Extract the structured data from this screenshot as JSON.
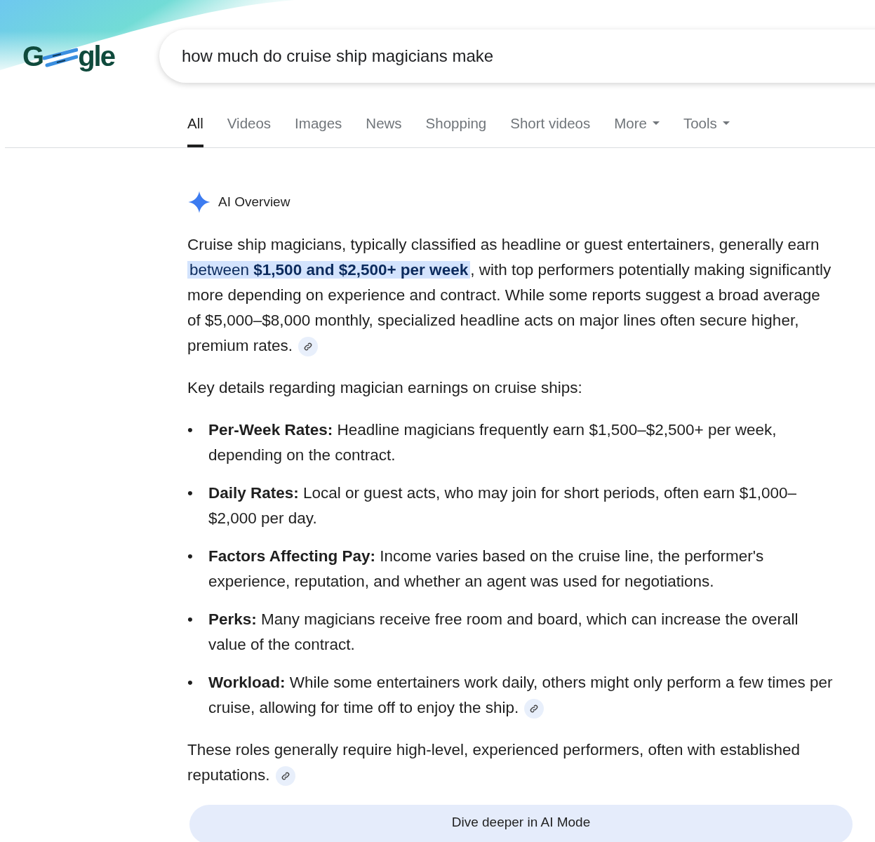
{
  "logo": {
    "first": "G",
    "last": "gle"
  },
  "search": {
    "value": "how much do cruise ship magicians make"
  },
  "tabs": [
    {
      "label": "All",
      "selected": true,
      "menu": false
    },
    {
      "label": "Videos",
      "selected": false,
      "menu": false
    },
    {
      "label": "Images",
      "selected": false,
      "menu": false
    },
    {
      "label": "News",
      "selected": false,
      "menu": false
    },
    {
      "label": "Shopping",
      "selected": false,
      "menu": false
    },
    {
      "label": "Short videos",
      "selected": false,
      "menu": false
    },
    {
      "label": "More",
      "selected": false,
      "menu": true
    },
    {
      "label": "Tools",
      "selected": false,
      "menu": true
    }
  ],
  "overview": {
    "title": "AI Overview",
    "intro": {
      "before": "Cruise ship magicians, typically classified as headline or guest entertainers, generally earn ",
      "highlight": "between **$1,500 and $2,500+ per week**",
      "after": ", with top performers potentially making significantly more depending on experience and contract. While some reports suggest a broad average of $5,000–$8,000 monthly, specialized headline acts on major lines often secure higher, premium rates.",
      "link": true
    },
    "lead": "Key details regarding magician earnings on cruise ships:",
    "bullets": [
      {
        "marker": "•",
        "text": "**Per-Week Rates:** Headline magicians frequently earn $1,500–$2,500+ per week, depending on the contract.",
        "link": false
      },
      {
        "marker": "•",
        "text": "**Daily Rates:** Local or guest acts, who may join for short periods, often earn $1,000–$2,000 per day.",
        "link": false
      },
      {
        "marker": "•",
        "text": "**Factors Affecting Pay:** Income varies based on the cruise line, the performer's experience, reputation, and whether an agent was used for negotiations.",
        "link": false
      },
      {
        "marker": "•",
        "text": "**Perks:** Many magicians receive free room and board, which can increase the overall value of the contract.",
        "link": false
      },
      {
        "marker": "•",
        "text": "**Workload:** While some entertainers work daily, others might only perform a few times per cruise, allowing for time off to enjoy the ship.",
        "link": true
      }
    ],
    "closing": {
      "text": "These roles generally require high-level, experienced performers, often with established reputations.",
      "link": true
    },
    "button": "Dive deeper in AI Mode"
  }
}
